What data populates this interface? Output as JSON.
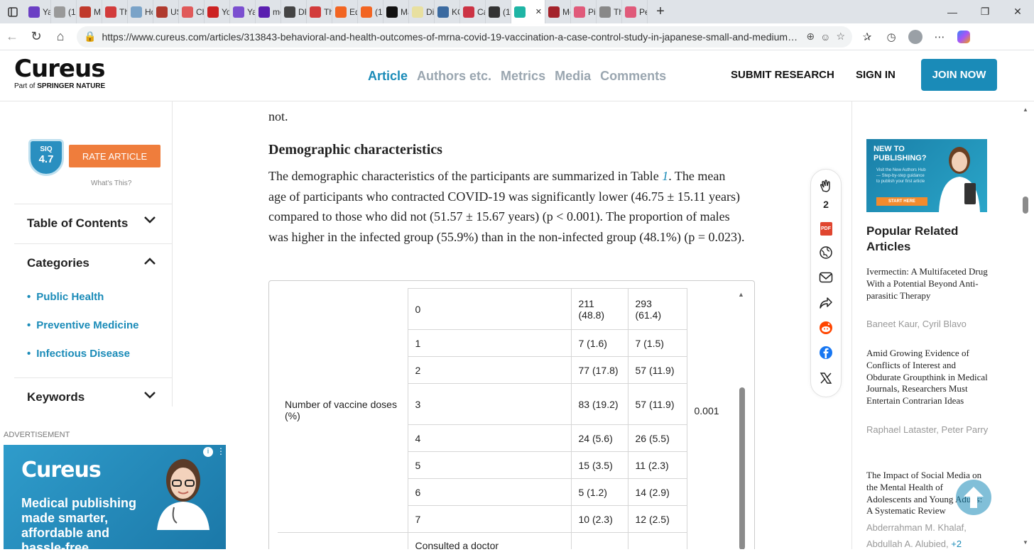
{
  "browser": {
    "tabs": [
      {
        "label": "Yah",
        "color": "#6b3fc4"
      },
      {
        "label": "(10(",
        "color": "#999999"
      },
      {
        "label": "MIT",
        "color": "#c0392b"
      },
      {
        "label": "Tha",
        "color": "#d23b3b"
      },
      {
        "label": "Hov",
        "color": "#7aa3c8"
      },
      {
        "label": "US/",
        "color": "#b03a2e"
      },
      {
        "label": "Che",
        "color": "#e05a5a"
      },
      {
        "label": "You",
        "color": "#cc2222"
      },
      {
        "label": "Yah",
        "color": "#7b4fd0"
      },
      {
        "label": "mo",
        "color": "#5a1fb0"
      },
      {
        "label": "DR",
        "color": "#444444"
      },
      {
        "label": "Tha",
        "color": "#d23b3b"
      },
      {
        "label": "Edit",
        "color": "#f26522"
      },
      {
        "label": "(10(",
        "color": "#f26522"
      },
      {
        "label": "Ma",
        "color": "#111111"
      },
      {
        "label": "Din",
        "color": "#e8e0a0"
      },
      {
        "label": "KCl",
        "color": "#3b6aa0"
      },
      {
        "label": "Car",
        "color": "#cc3344"
      },
      {
        "label": "(10(",
        "color": "#333333"
      },
      {
        "label": "",
        "color": "#1fb5a5"
      },
      {
        "label": "Mo",
        "color": "#a3222a"
      },
      {
        "label": "Pin",
        "color": "#e05a7a"
      },
      {
        "label": "The",
        "color": "#888888"
      },
      {
        "label": "Pet",
        "color": "#e05a7a"
      }
    ],
    "active_tab_index": 19,
    "url": "https://www.cureus.com/articles/313843-behavioral-and-health-outcomes-of-mrna-covid-19-vaccination-a-case-control-study-in-japanese-small-and-medium-sized-enterpri..."
  },
  "header": {
    "logo": "Cureus",
    "logo_sub_prefix": "Part of ",
    "logo_sub_brand": "SPRINGER NATURE",
    "nav": [
      "Article",
      "Authors etc.",
      "Metrics",
      "Media",
      "Comments"
    ],
    "submit": "SUBMIT RESEARCH",
    "signin": "SIGN IN",
    "join": "JOIN NOW"
  },
  "left": {
    "siq_label": "SIQ",
    "siq_value": "4.7",
    "rate_button": "RATE ARTICLE",
    "whats_this": "What's This?",
    "toc": "Table of Contents",
    "categories": "Categories",
    "category_items": [
      "Public Health",
      "Preventive Medicine",
      "Infectious Disease"
    ],
    "keywords": "Keywords",
    "advertisement": "ADVERTISEMENT",
    "ad_brand": "Cureus",
    "ad_text": "Medical publishing made smarter, affordable and hassle-free"
  },
  "article": {
    "prev_tail": "not.",
    "heading": "Demographic characteristics",
    "para_before_link": "The demographic characteristics of the participants are summarized in Table ",
    "table_link": "1",
    "para_after_link": ". The mean age of participants who contracted COVID-19 was significantly lower (46.75 ± 15.11 years) compared to those who did not (51.57 ± 15.67 years) (p < 0.001). The proportion of males was higher in the infected group (55.9%) than in the non-infected group (48.1%) (p = 0.023).",
    "table": {
      "group_label": "Number of vaccine doses (%)",
      "p_value": "0.001",
      "rows": [
        {
          "dose": "0",
          "infected": "211 (48.8)",
          "noninfected": "293 (61.4)"
        },
        {
          "dose": "1",
          "infected": "7 (1.6)",
          "noninfected": "7 (1.5)"
        },
        {
          "dose": "2",
          "infected": "77 (17.8)",
          "noninfected": "57 (11.9)"
        },
        {
          "dose": "3",
          "infected": "83 (19.2)",
          "noninfected": "57 (11.9)"
        },
        {
          "dose": "4",
          "infected": "24 (5.6)",
          "noninfected": "26 (5.5)"
        },
        {
          "dose": "5",
          "infected": "15 (3.5)",
          "noninfected": "11 (2.3)"
        },
        {
          "dose": "6",
          "infected": "5 (1.2)",
          "noninfected": "14 (2.9)"
        },
        {
          "dose": "7",
          "infected": "10 (2.3)",
          "noninfected": "12 (2.5)"
        }
      ],
      "next_row_partial": "Consulted a doctor"
    }
  },
  "share": {
    "clap_count": "2",
    "pdf_label": "PDF"
  },
  "right": {
    "promo_heading": "NEW TO PUBLISHING?",
    "promo_text": "Visit the New Authors Hub — Step-by-step guidance to publish your first article",
    "promo_button": "START HERE",
    "related_title": "Popular Related Articles",
    "articles": [
      {
        "title": "Ivermectin: A Multifaceted Drug With a Potential Beyond Anti-parasitic Therapy",
        "authors": "Baneet Kaur, Cyril Blavo",
        "more": ""
      },
      {
        "title": "Amid Growing Evidence of Conflicts of Interest and Obdurate Groupthink in Medical Journals, Researchers Must Entertain Contrarian Ideas",
        "authors": "Raphael Lataster, Peter Parry",
        "more": ""
      },
      {
        "title": "The Impact of Social Media on the Mental Health of Adolescents and Young Adults: A Systematic Review",
        "authors": "Abderrahman M. Khalaf, Abdullah A. Alubied, ",
        "more": "+2"
      }
    ]
  }
}
